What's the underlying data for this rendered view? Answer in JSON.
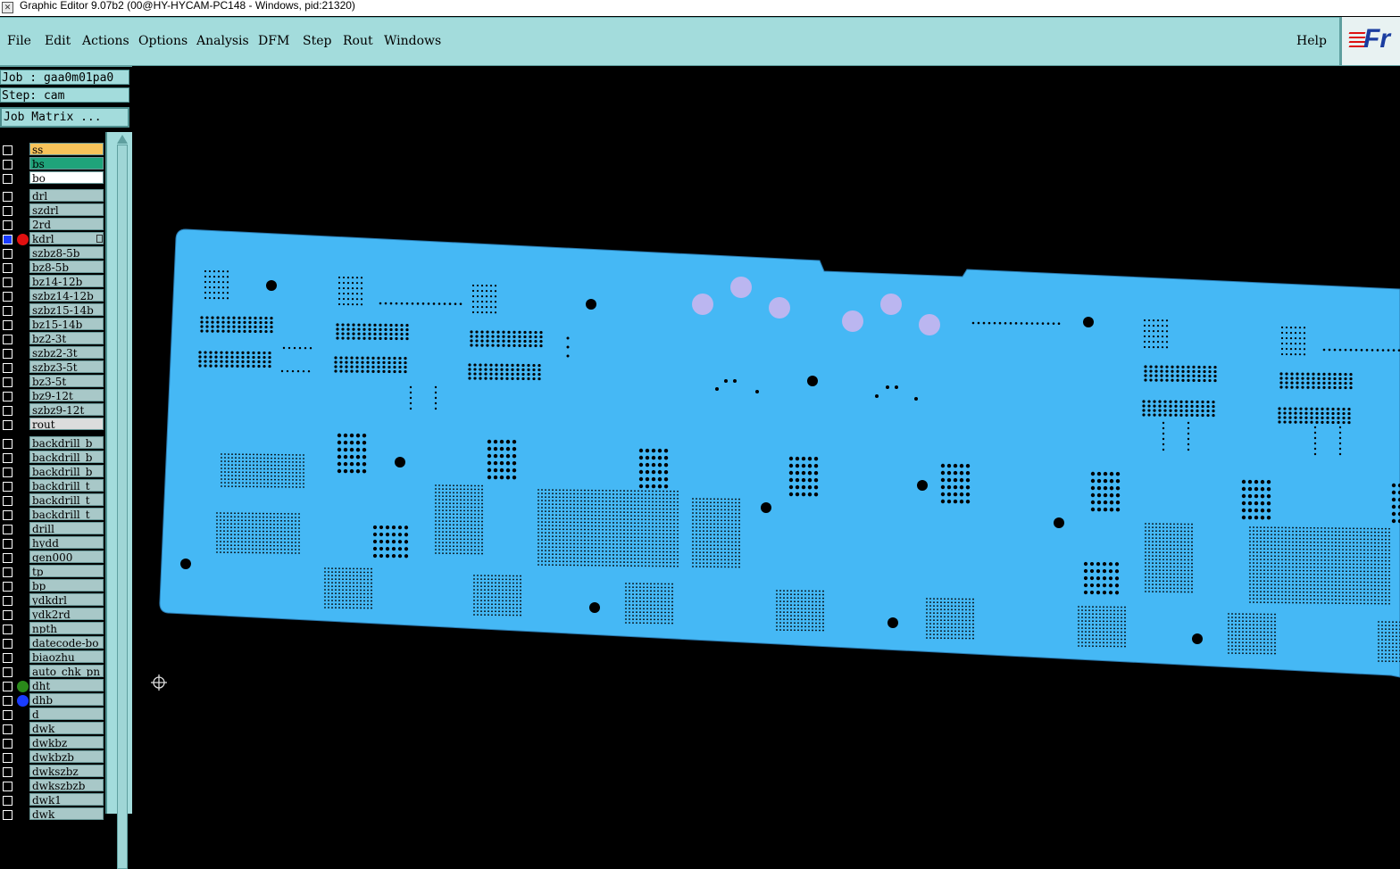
{
  "window": {
    "title": "Graphic Editor 9.07b2 (00@HY-HYCAM-PC148 - Windows, pid:21320)"
  },
  "menu": {
    "items": [
      "File",
      "Edit",
      "Actions",
      "Options",
      "Analysis",
      "DFM",
      "Step",
      "Rout",
      "Windows"
    ],
    "help": "Help"
  },
  "logo": {
    "text": "Fr"
  },
  "job": {
    "job_label": "Job : gaa0m01pa0",
    "step_label": "Step: cam",
    "matrix_button": "Job Matrix ..."
  },
  "layers": [
    {
      "name": "ss",
      "color": "#f7c35a",
      "dot": ""
    },
    {
      "name": "bs",
      "color": "#1fa37a",
      "dot": ""
    },
    {
      "name": "bo",
      "color": "#ffffff",
      "dot": ""
    },
    {
      "name": "drl",
      "color": "",
      "dot": ""
    },
    {
      "name": "szdrl",
      "color": "",
      "dot": ""
    },
    {
      "name": "2rd",
      "color": "",
      "dot": ""
    },
    {
      "name": "kdrl",
      "color": "",
      "dot": "#e01010",
      "active": true
    },
    {
      "name": "szbz8-5b",
      "color": "",
      "dot": ""
    },
    {
      "name": "bz8-5b",
      "color": "",
      "dot": ""
    },
    {
      "name": "bz14-12b",
      "color": "",
      "dot": ""
    },
    {
      "name": "szbz14-12b",
      "color": "",
      "dot": ""
    },
    {
      "name": "szbz15-14b",
      "color": "",
      "dot": ""
    },
    {
      "name": "bz15-14b",
      "color": "",
      "dot": ""
    },
    {
      "name": "bz2-3t",
      "color": "",
      "dot": ""
    },
    {
      "name": "szbz2-3t",
      "color": "",
      "dot": ""
    },
    {
      "name": "szbz3-5t",
      "color": "",
      "dot": ""
    },
    {
      "name": "bz3-5t",
      "color": "",
      "dot": ""
    },
    {
      "name": "bz9-12t",
      "color": "",
      "dot": ""
    },
    {
      "name": "szbz9-12t",
      "color": "",
      "dot": ""
    },
    {
      "name": "rout",
      "color": "#dcdcdc",
      "dot": ""
    },
    {
      "name": "backdrill_b",
      "color": "",
      "dot": ""
    },
    {
      "name": "backdrill_b",
      "color": "",
      "dot": ""
    },
    {
      "name": "backdrill_b",
      "color": "",
      "dot": ""
    },
    {
      "name": "backdrill_t",
      "color": "",
      "dot": ""
    },
    {
      "name": "backdrill_t",
      "color": "",
      "dot": ""
    },
    {
      "name": "backdrill_t",
      "color": "",
      "dot": ""
    },
    {
      "name": "drill",
      "color": "",
      "dot": ""
    },
    {
      "name": "hydd",
      "color": "",
      "dot": ""
    },
    {
      "name": "gen000",
      "color": "",
      "dot": ""
    },
    {
      "name": "tp",
      "color": "",
      "dot": ""
    },
    {
      "name": "bp",
      "color": "",
      "dot": ""
    },
    {
      "name": "ydkdrl",
      "color": "",
      "dot": ""
    },
    {
      "name": "ydk2rd",
      "color": "",
      "dot": ""
    },
    {
      "name": "npth",
      "color": "",
      "dot": ""
    },
    {
      "name": "datecode-bo",
      "color": "",
      "dot": ""
    },
    {
      "name": "biaozhu",
      "color": "",
      "dot": ""
    },
    {
      "name": "auto_chk_pn",
      "color": "",
      "dot": ""
    },
    {
      "name": "dht",
      "color": "",
      "dot": "#2a8a1a"
    },
    {
      "name": "dhb",
      "color": "",
      "dot": "#1a3cff"
    },
    {
      "name": "d",
      "color": "",
      "dot": ""
    },
    {
      "name": "dwk",
      "color": "",
      "dot": ""
    },
    {
      "name": "dwkbz",
      "color": "",
      "dot": ""
    },
    {
      "name": "dwkbzb",
      "color": "",
      "dot": ""
    },
    {
      "name": "dwkszbz",
      "color": "",
      "dot": ""
    },
    {
      "name": "dwkszbzb",
      "color": "",
      "dot": ""
    },
    {
      "name": "dwk1",
      "color": "",
      "dot": ""
    },
    {
      "name": "dwk",
      "color": "",
      "dot": ""
    }
  ],
  "board": {
    "fill": "#45b8f5",
    "hole_color": "#000000",
    "pad_color": "#bbb6f0"
  },
  "colors": {
    "toolbar_bg": "#a3dcdc",
    "canvas_bg": "#000000"
  }
}
